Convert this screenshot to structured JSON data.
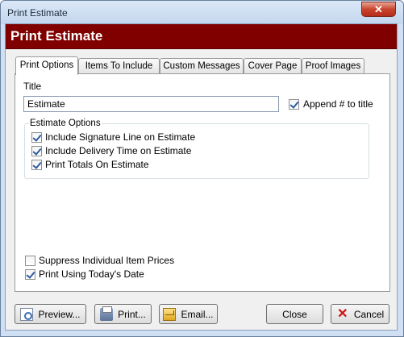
{
  "window": {
    "title": "Print Estimate",
    "close_glyph": "✕"
  },
  "header": {
    "title": "Print Estimate",
    "accent": "#800000"
  },
  "tabs": [
    {
      "label": "Print Options",
      "active": true
    },
    {
      "label": "Items To Include"
    },
    {
      "label": "Custom Messages"
    },
    {
      "label": "Cover Page"
    },
    {
      "label": "Proof Images"
    }
  ],
  "print_options": {
    "title_label": "Title",
    "title_value": "Estimate",
    "append_label": "Append # to title",
    "append_checked": true,
    "group_label": "Estimate Options",
    "options": [
      {
        "label": "Include Signature Line on Estimate",
        "checked": true
      },
      {
        "label": "Include Delivery Time on Estimate",
        "checked": true
      },
      {
        "label": "Print Totals On Estimate",
        "checked": true
      }
    ],
    "suppress_label": "Suppress Individual Item Prices",
    "suppress_checked": false,
    "today_label": "Print Using Today's Date",
    "today_checked": true
  },
  "buttons": {
    "preview": {
      "label": "Preview...",
      "icon": "preview-icon"
    },
    "print": {
      "label": "Print...",
      "icon": "printer-icon"
    },
    "email": {
      "label": "Email...",
      "icon": "email-icon"
    },
    "close": {
      "label": "Close"
    },
    "cancel": {
      "label": "Cancel",
      "icon": "cancel-icon",
      "glyph": "✕"
    }
  }
}
